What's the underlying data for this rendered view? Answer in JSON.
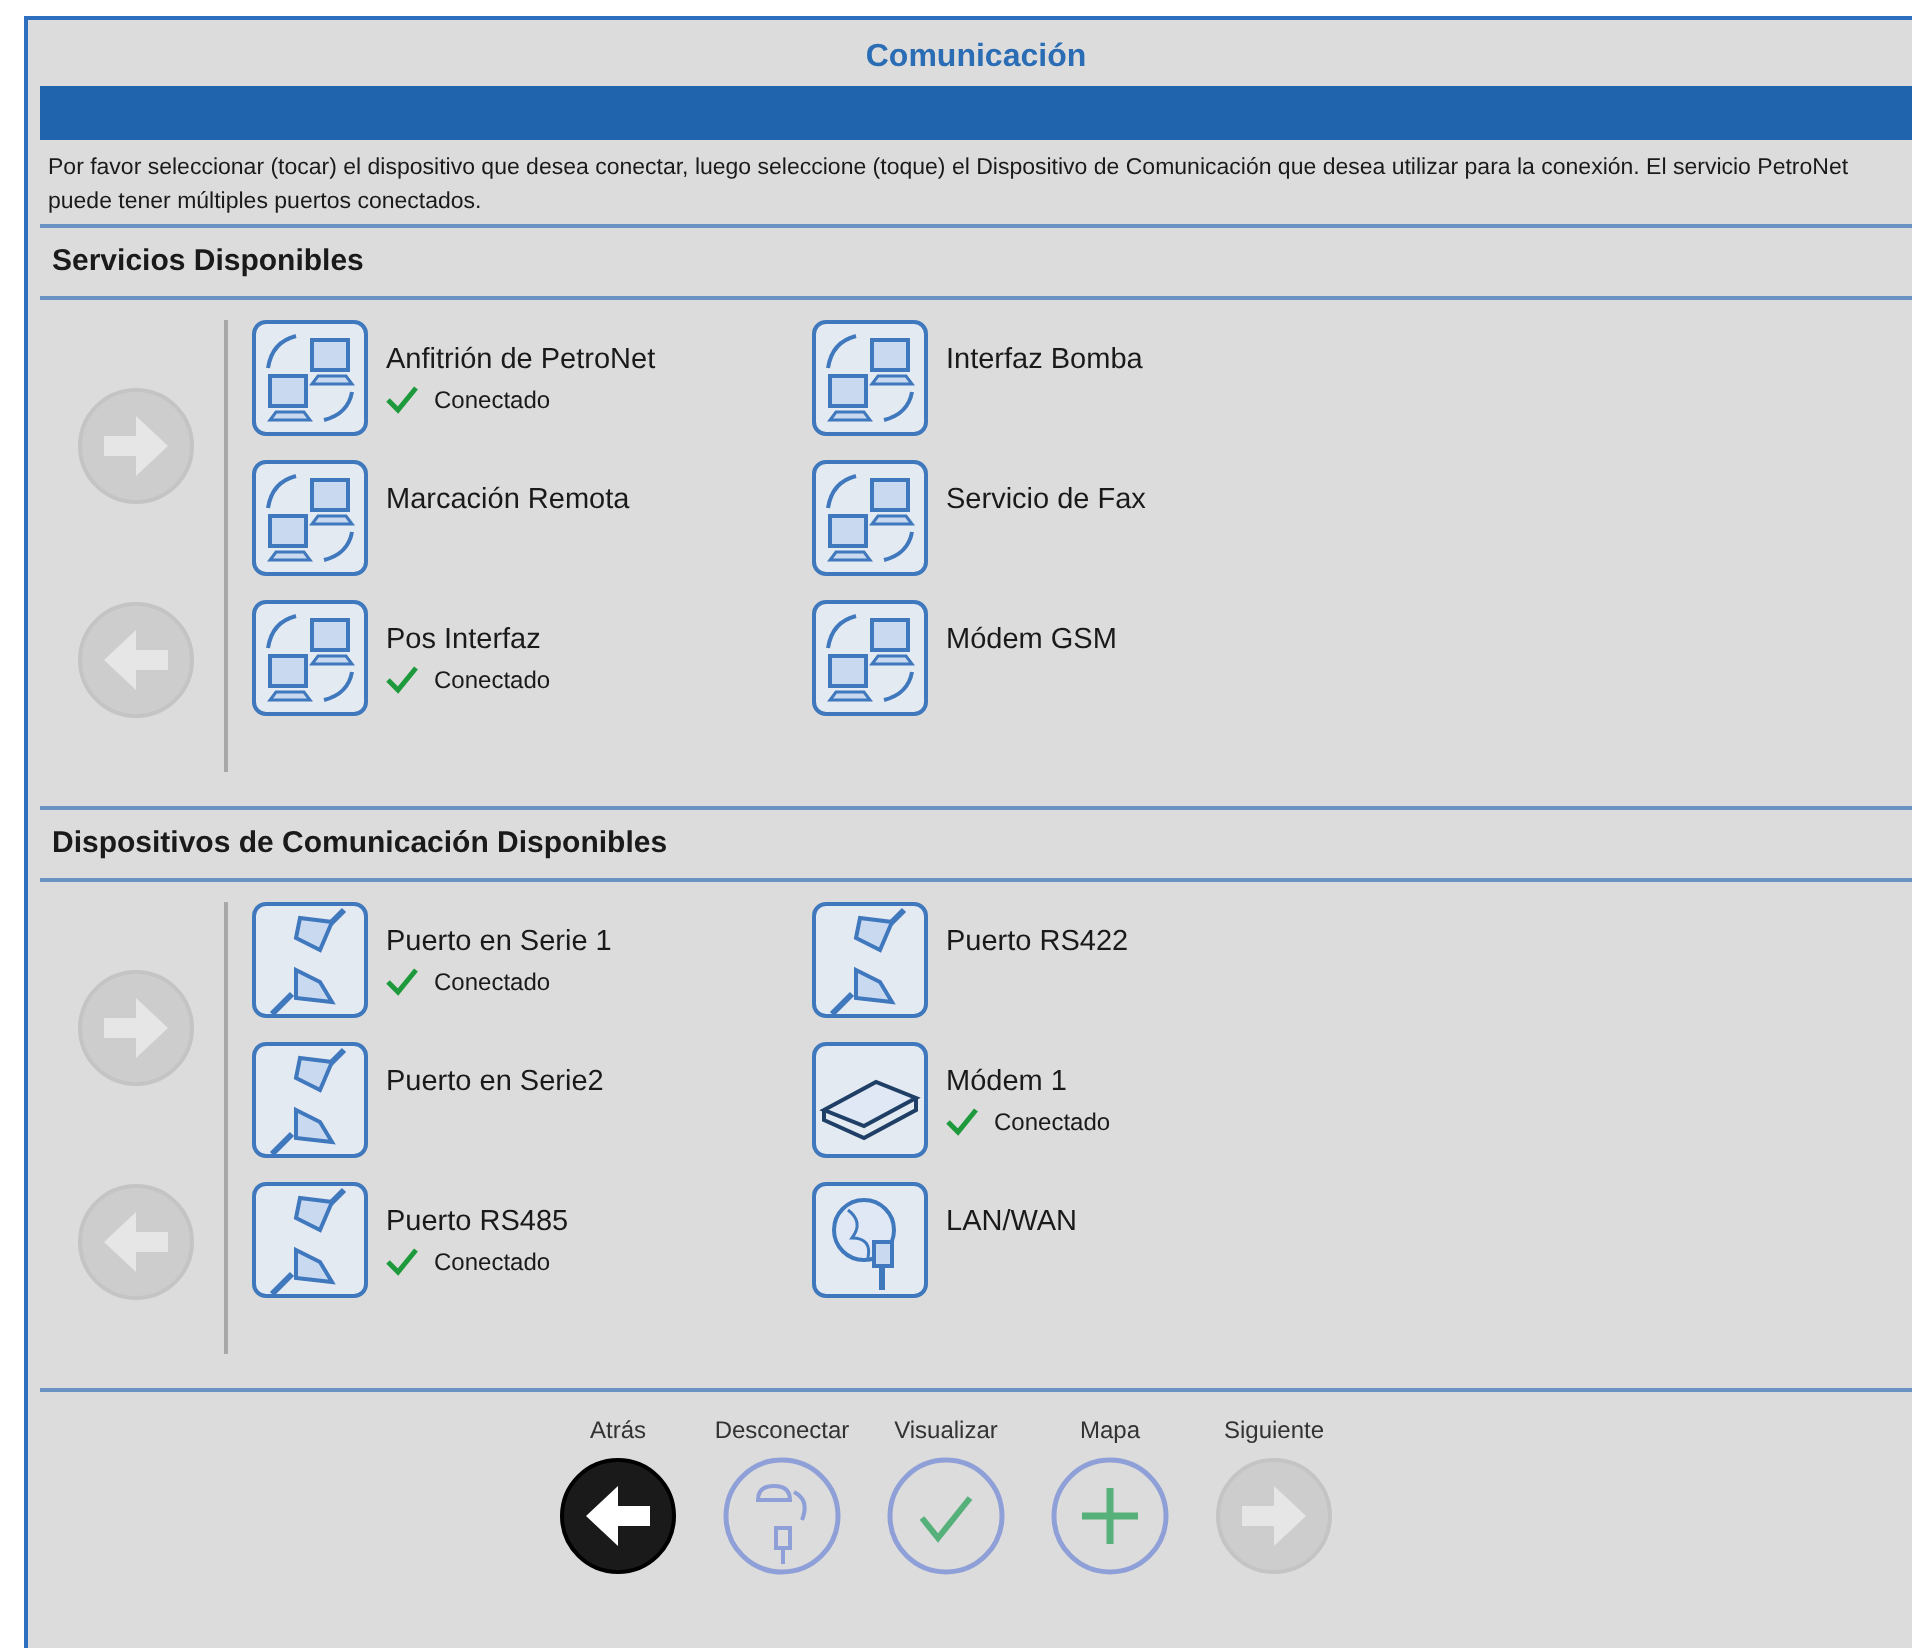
{
  "window": {
    "title": "Comunicación"
  },
  "instructions": "Por favor seleccionar (tocar) el dispositivo que desea conectar, luego seleccione (toque) el Dispositivo de Comunicación que desea utilizar para la conexión.  El servicio PetroNet puede tener múltiples puertos conectados.",
  "sections": [
    {
      "title": "Servicios Disponibles",
      "pager": [
        {
          "kind": "next",
          "disabled": true
        },
        {
          "kind": "prev",
          "disabled": true
        }
      ],
      "items": [
        {
          "label": "Anfitrión de PetroNet",
          "kind": "network",
          "status": "Conectado"
        },
        {
          "label": "Interfaz Bomba",
          "kind": "network"
        },
        {
          "label": "Marcación Remota",
          "kind": "network"
        },
        {
          "label": "Servicio de Fax",
          "kind": "network"
        },
        {
          "label": "Pos Interfaz",
          "kind": "network",
          "status": "Conectado"
        },
        {
          "label": "Módem GSM",
          "kind": "network"
        }
      ]
    },
    {
      "title": "Dispositivos de Comunicación Disponibles",
      "pager": [
        {
          "kind": "next",
          "disabled": true
        },
        {
          "kind": "prev",
          "disabled": true
        }
      ],
      "items": [
        {
          "label": "Puerto en Serie 1",
          "kind": "serial",
          "status": "Conectado"
        },
        {
          "label": "Puerto RS422",
          "kind": "serial"
        },
        {
          "label": "Puerto en Serie2",
          "kind": "serial"
        },
        {
          "label": "Módem 1",
          "kind": "modem",
          "status": "Conectado"
        },
        {
          "label": "Puerto RS485",
          "kind": "serial",
          "status": "Conectado"
        },
        {
          "label": "LAN/WAN",
          "kind": "lan"
        }
      ]
    }
  ],
  "toolbar": [
    {
      "label": "Atrás",
      "kind": "back",
      "disabled": false
    },
    {
      "label": "Desconectar",
      "kind": "disconnect",
      "disabled": false
    },
    {
      "label": "Visualizar",
      "kind": "view",
      "disabled": false
    },
    {
      "label": "Mapa",
      "kind": "map",
      "disabled": false
    },
    {
      "label": "Siguiente",
      "kind": "next",
      "disabled": true
    }
  ]
}
